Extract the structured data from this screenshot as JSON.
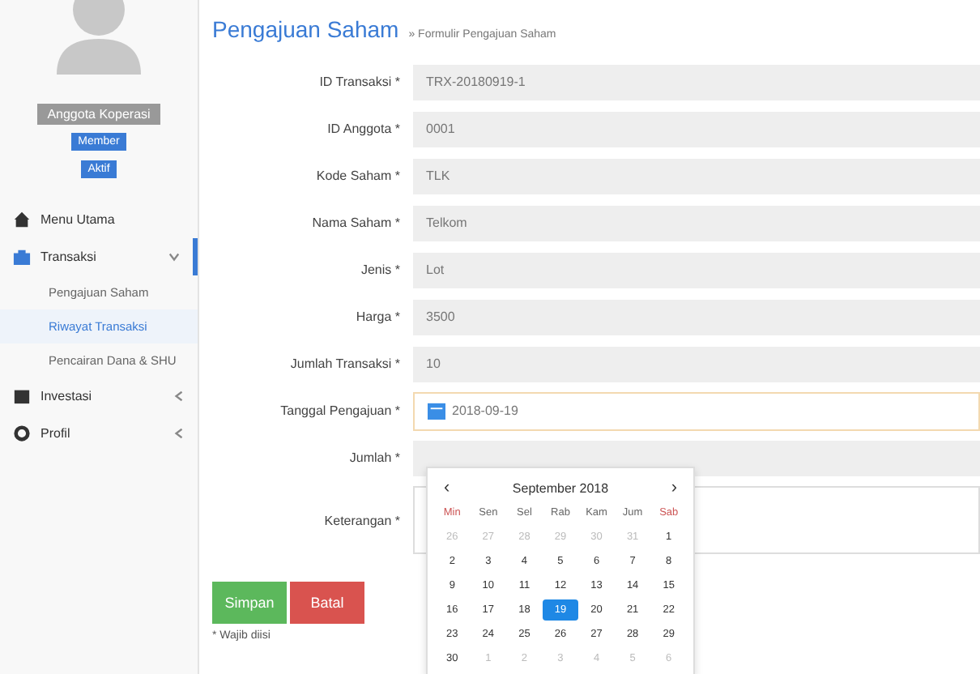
{
  "sidebar": {
    "user_name": "Anggota Koperasi",
    "role_badge": "Member",
    "status_badge": "Aktif",
    "items": [
      {
        "label": "Menu Utama",
        "expanded": false,
        "has_children": false
      },
      {
        "label": "Transaksi",
        "expanded": true,
        "has_children": true,
        "children": [
          {
            "label": "Pengajuan Saham",
            "selected": false
          },
          {
            "label": "Riwayat Transaksi",
            "selected": true
          },
          {
            "label": "Pencairan Dana & SHU",
            "selected": false
          }
        ]
      },
      {
        "label": "Investasi",
        "expanded": false,
        "has_children": true
      },
      {
        "label": "Profil",
        "expanded": false,
        "has_children": true
      }
    ]
  },
  "page": {
    "title": "Pengajuan Saham",
    "subtitle": "» Formulir Pengajuan Saham"
  },
  "form": [
    {
      "kind": "text",
      "label": "ID Transaksi *",
      "value": "TRX-20180919-1"
    },
    {
      "kind": "text",
      "label": "ID Anggota *",
      "value": "0001"
    },
    {
      "kind": "text",
      "label": "Kode Saham *",
      "value": "TLK"
    },
    {
      "kind": "text",
      "label": "Nama Saham *",
      "value": "Telkom"
    },
    {
      "kind": "text",
      "label": "Jenis *",
      "value": "Lot"
    },
    {
      "kind": "text",
      "label": "Harga *",
      "value": "3500"
    },
    {
      "kind": "text",
      "label": "Jumlah Transaksi *",
      "value": "10"
    },
    {
      "kind": "date",
      "label": "Tanggal Pengajuan *",
      "value": "2018-09-19"
    },
    {
      "kind": "text",
      "label": "Jumlah *"
    },
    {
      "kind": "textarea",
      "label": "Keterangan *"
    }
  ],
  "calendar": {
    "month": "September 2018",
    "prev": "‹",
    "next": "›",
    "weekdays": [
      "Min",
      "Sen",
      "Sel",
      "Rab",
      "Kam",
      "Jum",
      "Sab"
    ],
    "weeks": [
      [
        {
          "d": "26",
          "other": true,
          "selected": false
        },
        {
          "d": "27",
          "other": true,
          "selected": false
        },
        {
          "d": "28",
          "other": true,
          "selected": false
        },
        {
          "d": "29",
          "other": true,
          "selected": false
        },
        {
          "d": "30",
          "other": true,
          "selected": false
        },
        {
          "d": "31",
          "other": true,
          "selected": false
        },
        {
          "d": "1",
          "other": false,
          "selected": false
        }
      ],
      [
        {
          "d": "2",
          "other": false,
          "selected": false
        },
        {
          "d": "3",
          "other": false,
          "selected": false
        },
        {
          "d": "4",
          "other": false,
          "selected": false
        },
        {
          "d": "5",
          "other": false,
          "selected": false
        },
        {
          "d": "6",
          "other": false,
          "selected": false
        },
        {
          "d": "7",
          "other": false,
          "selected": false
        },
        {
          "d": "8",
          "other": false,
          "selected": false
        }
      ],
      [
        {
          "d": "9",
          "other": false,
          "selected": false
        },
        {
          "d": "10",
          "other": false,
          "selected": false
        },
        {
          "d": "11",
          "other": false,
          "selected": false
        },
        {
          "d": "12",
          "other": false,
          "selected": false
        },
        {
          "d": "13",
          "other": false,
          "selected": false
        },
        {
          "d": "14",
          "other": false,
          "selected": false
        },
        {
          "d": "15",
          "other": false,
          "selected": false
        }
      ],
      [
        {
          "d": "16",
          "other": false,
          "selected": false
        },
        {
          "d": "17",
          "other": false,
          "selected": false
        },
        {
          "d": "18",
          "other": false,
          "selected": false
        },
        {
          "d": "19",
          "other": false,
          "selected": true
        },
        {
          "d": "20",
          "other": false,
          "selected": false
        },
        {
          "d": "21",
          "other": false,
          "selected": false
        },
        {
          "d": "22",
          "other": false,
          "selected": false
        }
      ],
      [
        {
          "d": "23",
          "other": false,
          "selected": false
        },
        {
          "d": "24",
          "other": false,
          "selected": false
        },
        {
          "d": "25",
          "other": false,
          "selected": false
        },
        {
          "d": "26",
          "other": false,
          "selected": false
        },
        {
          "d": "27",
          "other": false,
          "selected": false
        },
        {
          "d": "28",
          "other": false,
          "selected": false
        },
        {
          "d": "29",
          "other": false,
          "selected": false
        }
      ],
      [
        {
          "d": "30",
          "other": false,
          "selected": false
        },
        {
          "d": "1",
          "other": true,
          "selected": false
        },
        {
          "d": "2",
          "other": true,
          "selected": false
        },
        {
          "d": "3",
          "other": true,
          "selected": false
        },
        {
          "d": "4",
          "other": true,
          "selected": false
        },
        {
          "d": "5",
          "other": true,
          "selected": false
        },
        {
          "d": "6",
          "other": true,
          "selected": false
        }
      ]
    ]
  },
  "buttons": [
    {
      "kind": "save",
      "label": "Simpan"
    },
    {
      "kind": "cancel",
      "label": "Batal"
    }
  ],
  "note": "* Wajib diisi"
}
